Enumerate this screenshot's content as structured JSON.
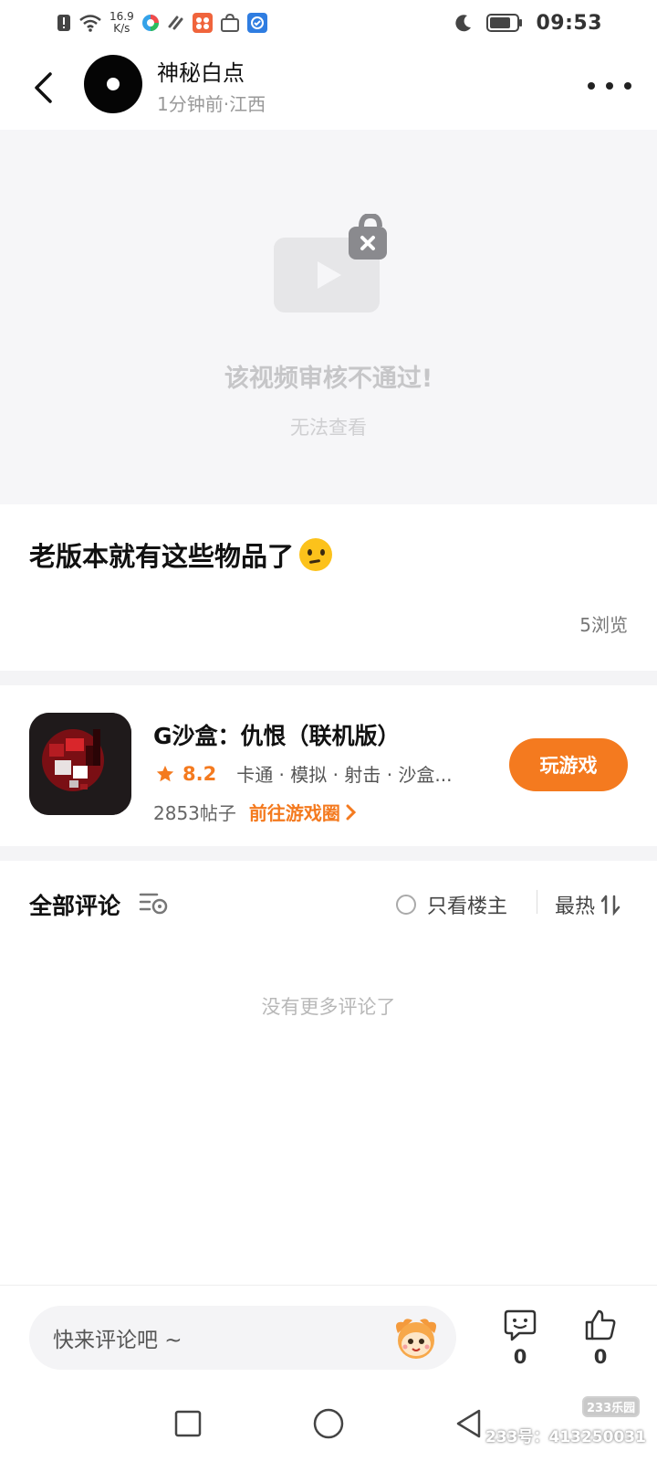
{
  "status_bar": {
    "net_speed_value": "16.9",
    "net_speed_unit": "K/s",
    "time": "09:53"
  },
  "header": {
    "author_name": "神秘白点",
    "author_meta": "1分钟前·江西"
  },
  "video": {
    "status_title": "该视频审核不通过!",
    "status_sub": "无法查看"
  },
  "post": {
    "title": "老版本就有这些物品了",
    "views": "5浏览"
  },
  "game": {
    "name": "G沙盒：仇恨（联机版）",
    "rating": "8.2",
    "tags": "卡通 · 模拟 · 射击 · 沙盒...",
    "posts": "2853帖子",
    "go_circle": "前往游戏圈",
    "play_button": "玩游戏"
  },
  "comments": {
    "title": "全部评论",
    "only_op": "只看楼主",
    "sort": "最热",
    "empty": "没有更多评论了"
  },
  "bottom_bar": {
    "input_placeholder": "快来评论吧 ~",
    "comment_count": "0",
    "like_count": "0"
  },
  "watermark": {
    "badge": "233乐园",
    "text": "233号：413250031"
  },
  "colors": {
    "accent": "#f47a1f",
    "page_bg": "#f6f6f8"
  }
}
